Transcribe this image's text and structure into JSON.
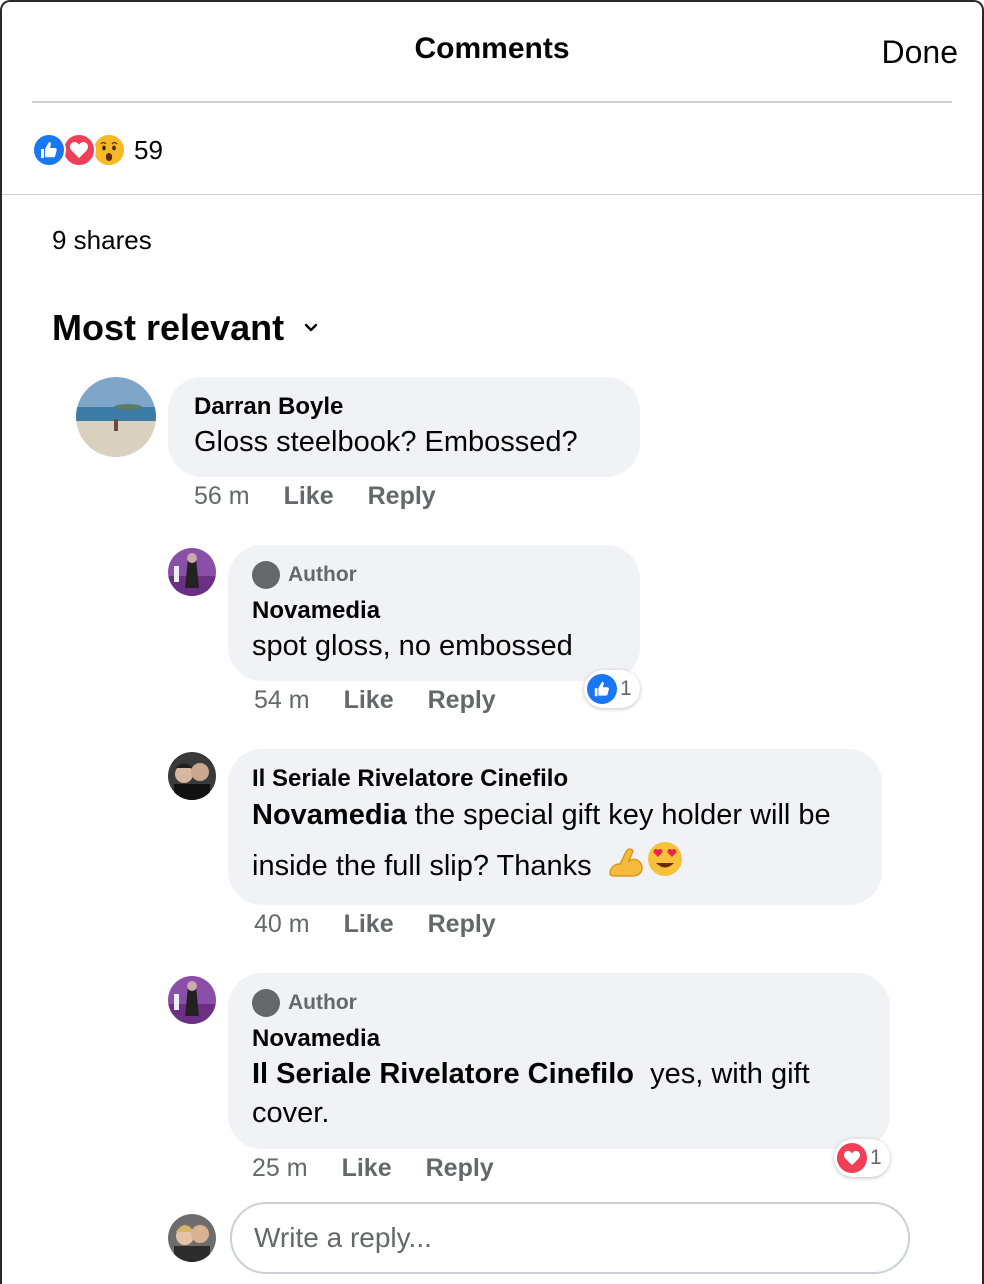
{
  "header": {
    "title": "Comments",
    "done_label": "Done"
  },
  "reactions": {
    "count": "59",
    "icons": [
      "like-icon",
      "love-icon",
      "wow-icon"
    ]
  },
  "shares": "9 shares",
  "sort": {
    "label": "Most relevant"
  },
  "comments": [
    {
      "author": "Darran Boyle",
      "text": "Gloss steelbook? Embossed?",
      "time": "56 m",
      "like": "Like",
      "reply": "Reply"
    },
    {
      "badge": "Author",
      "author": "Novamedia",
      "text": "spot gloss, no embossed",
      "time": "54 m",
      "like": "Like",
      "reply": "Reply",
      "reaction_count": "1"
    },
    {
      "author": "Il Seriale Rivelatore Cinefilo",
      "mention": "Novamedia",
      "text": " the special gift key holder will be inside the full slip? Thanks ",
      "time": "40 m",
      "like": "Like",
      "reply": "Reply"
    },
    {
      "badge": "Author",
      "author": "Novamedia",
      "mention": "Il Seriale Rivelatore Cinefilo",
      "text": "  yes, with gift cover.",
      "time": "25 m",
      "like": "Like",
      "reply": "Reply",
      "reaction_count": "1"
    }
  ],
  "reply_box": {
    "placeholder": "Write a reply..."
  },
  "colors": {
    "like_blue": "#1877f2",
    "love_red": "#f33e58",
    "bubble_gray": "#f0f2f5",
    "meta_gray": "#65676b"
  }
}
